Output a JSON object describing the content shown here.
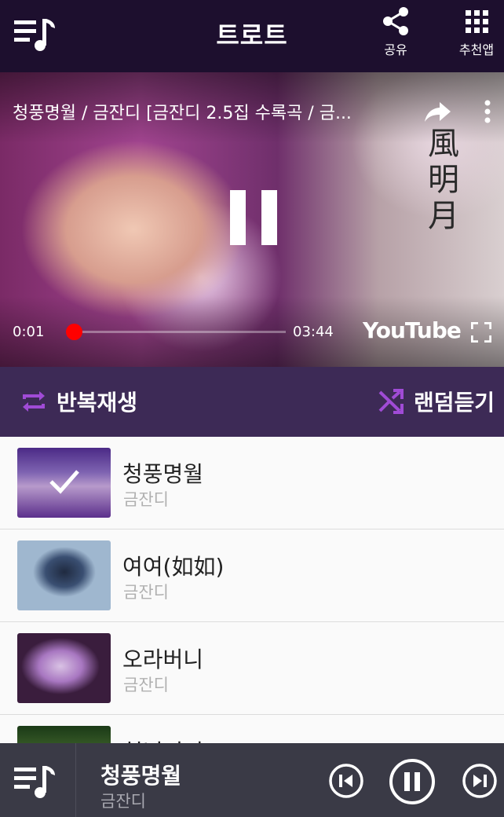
{
  "app": {
    "title": "트로트",
    "share_label": "공유",
    "apps_label": "추천앱",
    "icons": {
      "logo": "playlist-music-icon",
      "share": "share-icon",
      "apps": "grid-icon"
    }
  },
  "video": {
    "title": "청풍명월 / 금잔디 [금잔디 2.5집 수록곡 / 금...",
    "overlay_text": "風明月",
    "current_time": "0:01",
    "duration": "03:44",
    "progress": 0.005,
    "brand": "YouTube",
    "state": "playing",
    "accent_color": "#ff0000"
  },
  "modes": {
    "repeat_label": "반복재생",
    "shuffle_label": "랜덤듣기",
    "icon_color": "#a04bd6"
  },
  "playlist": [
    {
      "title": "청풍명월",
      "artist": "금잔디",
      "selected": true
    },
    {
      "title": "여여(如如)",
      "artist": "금잔디",
      "selected": false
    },
    {
      "title": "오라버니",
      "artist": "금잔디",
      "selected": false
    },
    {
      "title": "천년지기",
      "artist": "",
      "selected": false
    }
  ],
  "now_playing": {
    "title": "청풍명월",
    "artist": "금잔디"
  },
  "colors": {
    "top_bar": "#1d0f2e",
    "mode_bar": "#3d2a56",
    "player_bar": "#3a3a46"
  }
}
